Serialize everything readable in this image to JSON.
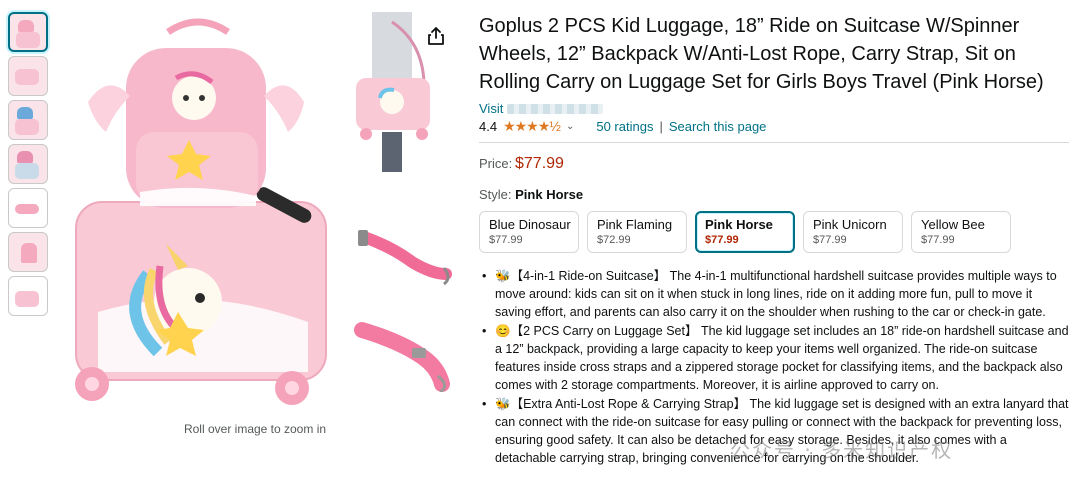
{
  "product": {
    "title": "Goplus 2 PCS Kid Luggage, 18” Ride on Suitcase W/Spinner Wheels, 12” Backpack W/Anti-Lost Rope, Carry Strap, Sit on Rolling Carry on Luggage Set for Girls Boys Travel (Pink Horse)",
    "visit_label": "Visit",
    "rating_value": "4.4",
    "rating_fraction": 0.88,
    "stars": "★★★★½",
    "ratings_link": "50 ratings",
    "search_link": "Search this page",
    "price_label": "Price:",
    "price": "$77.99",
    "style_label": "Style:",
    "style_selected": "Pink Horse"
  },
  "gallery": {
    "zoom_hint": "Roll over image to zoom in",
    "thumb_count": 7,
    "share_icon": "share-icon"
  },
  "styles": [
    {
      "name": "Blue Dinosaur",
      "price": "$77.99"
    },
    {
      "name": "Pink Flaming",
      "price": "$72.99"
    },
    {
      "name": "Pink Horse",
      "price": "$77.99"
    },
    {
      "name": "Pink Unicorn",
      "price": "$77.99"
    },
    {
      "name": "Yellow Bee",
      "price": "$77.99"
    }
  ],
  "bullets": [
    "🐝【4-in-1 Ride-on Suitcase】 The 4-in-1 multifunctional hardshell suitcase provides multiple ways to move around: kids can sit on it when stuck in long lines, ride on it adding more fun, pull to move it saving effort, and parents can also carry it on the shoulder when rushing to the car or check-in gate.",
    "😊【2 PCS Carry on Luggage Set】 The kid luggage set includes an 18” ride-on hardshell suitcase and a 12” backpack, providing a large capacity to keep your items well organized. The ride-on suitcase features inside cross straps and a zippered storage pocket for classifying items, and the backpack also comes with 2 storage compartments. Moreover, it is airline approved to carry on.",
    "🐝【Extra Anti-Lost Rope & Carrying Strap】 The kid luggage set is designed with an extra lanyard that can connect with the ride-on suitcase for easy pulling or connect with the backpack for preventing loss, ensuring good safety. It can also be detached for easy storage. Besides, it also comes with a detachable carrying strap, bringing convenience for carrying on the shoulder."
  ],
  "watermark": "公众号 · 多米知识产权",
  "colors": {
    "link": "#007185",
    "price": "#b12704",
    "star": "#de7921",
    "pink": "#f7b8cb"
  }
}
